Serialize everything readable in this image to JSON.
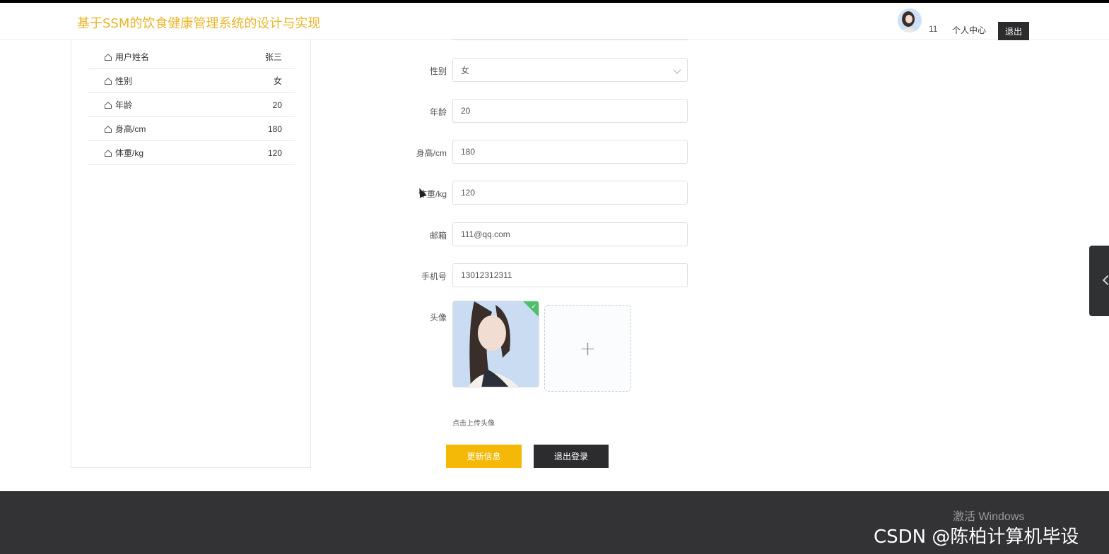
{
  "header": {
    "title": "基于SSM的饮食健康管理系统的设计与实现",
    "user_name": "11",
    "user_center": "个人中心",
    "logout": "退出"
  },
  "sidebar": {
    "rows": [
      {
        "label": "用户姓名",
        "value": "张三",
        "icon": "home-icon"
      },
      {
        "label": "性别",
        "value": "女",
        "icon": "home-icon"
      },
      {
        "label": "年龄",
        "value": "20",
        "icon": "home-icon"
      },
      {
        "label": "身高/cm",
        "value": "180",
        "icon": "home-icon"
      },
      {
        "label": "体重/kg",
        "value": "120",
        "icon": "home-icon"
      }
    ]
  },
  "form": {
    "gender": {
      "label": "性别",
      "value": "女"
    },
    "age": {
      "label": "年龄",
      "value": "20"
    },
    "height": {
      "label": "身高/cm",
      "value": "180"
    },
    "weight": {
      "label": "体重/kg",
      "value": "120"
    },
    "email": {
      "label": "邮箱",
      "value": "111@qq.com"
    },
    "phone": {
      "label": "手机号",
      "value": "13012312311"
    },
    "avatar": {
      "label": "头像",
      "hint": "点击上传头像",
      "upload_icon": "plus-icon"
    },
    "update_button": "更新信息",
    "logout_button": "退出登录"
  },
  "footer": {
    "windows_activation": "激活 Windows",
    "watermark": "CSDN @陈柏计算机毕设"
  },
  "colors": {
    "accent": "#f3b906",
    "title": "#e9b52a",
    "dark": "#2c2c2e",
    "footer_bg": "#333336",
    "success": "#4fc06a"
  }
}
